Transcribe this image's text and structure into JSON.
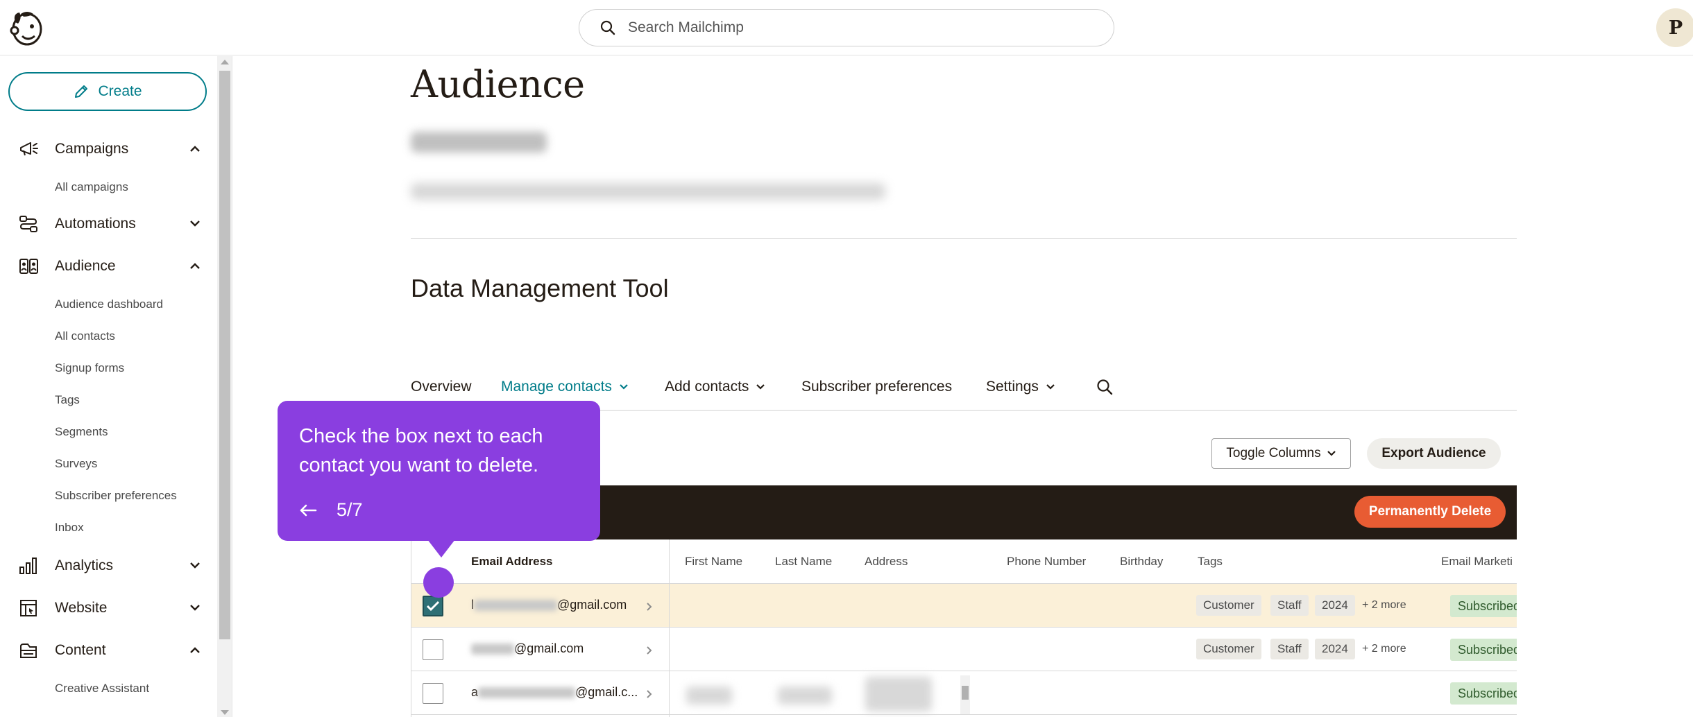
{
  "search": {
    "placeholder": "Search Mailchimp"
  },
  "user": {
    "initial": "P"
  },
  "sidebar": {
    "create_label": "Create",
    "sections": [
      {
        "label": "Campaigns",
        "icon": "megaphone-icon",
        "expanded": true,
        "items": [
          "All campaigns"
        ]
      },
      {
        "label": "Automations",
        "icon": "automations-icon",
        "expanded": false,
        "items": []
      },
      {
        "label": "Audience",
        "icon": "audience-icon",
        "expanded": true,
        "items": [
          "Audience dashboard",
          "All contacts",
          "Signup forms",
          "Tags",
          "Segments",
          "Surveys",
          "Subscriber preferences",
          "Inbox"
        ]
      },
      {
        "label": "Analytics",
        "icon": "bar-chart-icon",
        "expanded": false,
        "items": []
      },
      {
        "label": "Website",
        "icon": "website-icon",
        "expanded": false,
        "items": []
      },
      {
        "label": "Content",
        "icon": "content-icon",
        "expanded": true,
        "items": [
          "Creative Assistant"
        ]
      }
    ]
  },
  "main": {
    "title": "Audience",
    "section_title": "Data Management Tool",
    "tabs": [
      {
        "label": "Overview",
        "active": false,
        "has_dropdown": false
      },
      {
        "label": "Manage contacts",
        "active": true,
        "has_dropdown": true
      },
      {
        "label": "Add contacts",
        "active": false,
        "has_dropdown": true
      },
      {
        "label": "Subscriber preferences",
        "active": false,
        "has_dropdown": false
      },
      {
        "label": "Settings",
        "active": false,
        "has_dropdown": true
      }
    ],
    "toggle_columns_label": "Toggle Columns",
    "export_label": "Export Audience",
    "delete_label": "Permanently Delete"
  },
  "table": {
    "columns": [
      "Email Address",
      "First Name",
      "Last Name",
      "Address",
      "Phone Number",
      "Birthday",
      "Tags",
      "Email Marketi"
    ],
    "rows": [
      {
        "email_visible": "@gmail.com",
        "email_prefix": "l",
        "checked": true,
        "tags": [
          "Customer",
          "Staff",
          "2024"
        ],
        "more": "+ 2 more",
        "status": "Subscribed"
      },
      {
        "email_visible": "@gmail.com",
        "email_prefix": "",
        "checked": false,
        "tags": [
          "Customer",
          "Staff",
          "2024"
        ],
        "more": "+ 2 more",
        "status": "Subscribed"
      },
      {
        "email_visible": "@gmail.c...",
        "email_prefix": "a",
        "checked": false,
        "tags": [],
        "more": "",
        "status": "Subscribed"
      }
    ]
  },
  "tooltip": {
    "text": "Check the box next to each contact you want to delete.",
    "step": "5/7"
  },
  "colors": {
    "accent": "#007c89",
    "tooltip": "#8a3ee0",
    "danger": "#e85c33",
    "dark": "#241c15",
    "selected_row": "#fbf0d8"
  }
}
